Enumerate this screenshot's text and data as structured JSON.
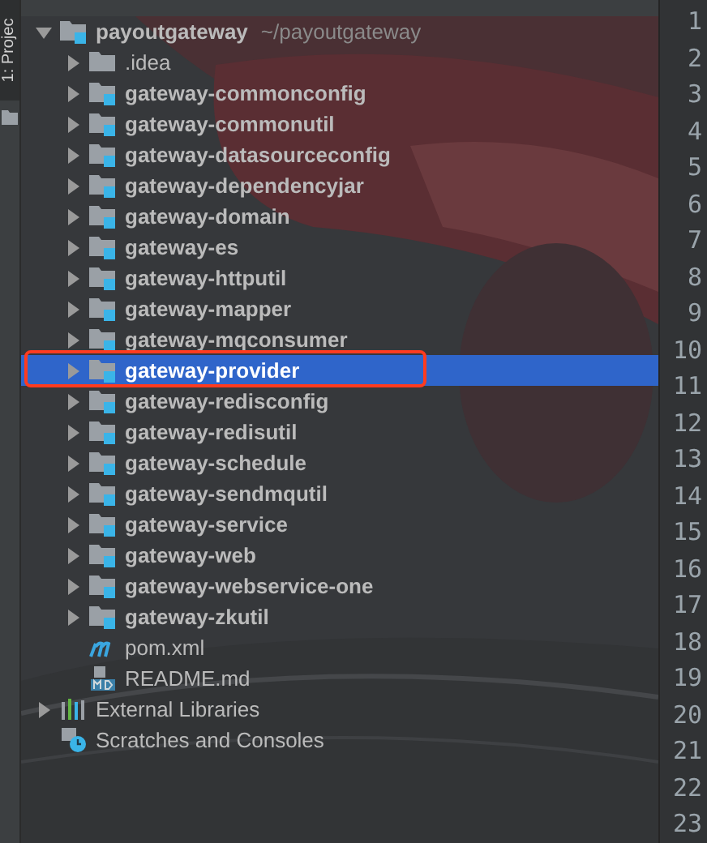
{
  "side_tab": "1: Projec",
  "tree": [
    {
      "label": "payoutgateway",
      "path": "~/payoutgateway",
      "kind": "module",
      "expanded": true,
      "selected": false,
      "children": [
        {
          "label": ".idea",
          "kind": "folder",
          "expanded": false,
          "selected": false
        },
        {
          "label": "gateway-commonconfig",
          "kind": "module",
          "expanded": false,
          "selected": false
        },
        {
          "label": "gateway-commonutil",
          "kind": "module",
          "expanded": false,
          "selected": false
        },
        {
          "label": "gateway-datasourceconfig",
          "kind": "module",
          "expanded": false,
          "selected": false
        },
        {
          "label": "gateway-dependencyjar",
          "kind": "module",
          "expanded": false,
          "selected": false
        },
        {
          "label": "gateway-domain",
          "kind": "module",
          "expanded": false,
          "selected": false
        },
        {
          "label": "gateway-es",
          "kind": "module",
          "expanded": false,
          "selected": false
        },
        {
          "label": "gateway-httputil",
          "kind": "module",
          "expanded": false,
          "selected": false
        },
        {
          "label": "gateway-mapper",
          "kind": "module",
          "expanded": false,
          "selected": false
        },
        {
          "label": "gateway-mqconsumer",
          "kind": "module",
          "expanded": false,
          "selected": false
        },
        {
          "label": "gateway-provider",
          "kind": "module",
          "expanded": false,
          "selected": true
        },
        {
          "label": "gateway-redisconfig",
          "kind": "module",
          "expanded": false,
          "selected": false
        },
        {
          "label": "gateway-redisutil",
          "kind": "module",
          "expanded": false,
          "selected": false
        },
        {
          "label": "gateway-schedule",
          "kind": "module",
          "expanded": false,
          "selected": false
        },
        {
          "label": "gateway-sendmqutil",
          "kind": "module",
          "expanded": false,
          "selected": false
        },
        {
          "label": "gateway-service",
          "kind": "module",
          "expanded": false,
          "selected": false
        },
        {
          "label": "gateway-web",
          "kind": "module",
          "expanded": false,
          "selected": false
        },
        {
          "label": "gateway-webservice-one",
          "kind": "module",
          "expanded": false,
          "selected": false
        },
        {
          "label": "gateway-zkutil",
          "kind": "module",
          "expanded": false,
          "selected": false
        },
        {
          "label": "pom.xml",
          "kind": "maven",
          "selected": false
        },
        {
          "label": "README.md",
          "kind": "markdown",
          "selected": false
        }
      ]
    },
    {
      "label": "External Libraries",
      "kind": "libraries",
      "expanded": false,
      "selected": false
    },
    {
      "label": "Scratches and Consoles",
      "kind": "scratches",
      "selected": false
    }
  ],
  "line_numbers": [
    "1",
    "2",
    "3",
    "4",
    "5",
    "6",
    "7",
    "8",
    "9",
    "10",
    "11",
    "12",
    "13",
    "14",
    "15",
    "16",
    "17",
    "18",
    "19",
    "20",
    "21",
    "22",
    "23"
  ]
}
